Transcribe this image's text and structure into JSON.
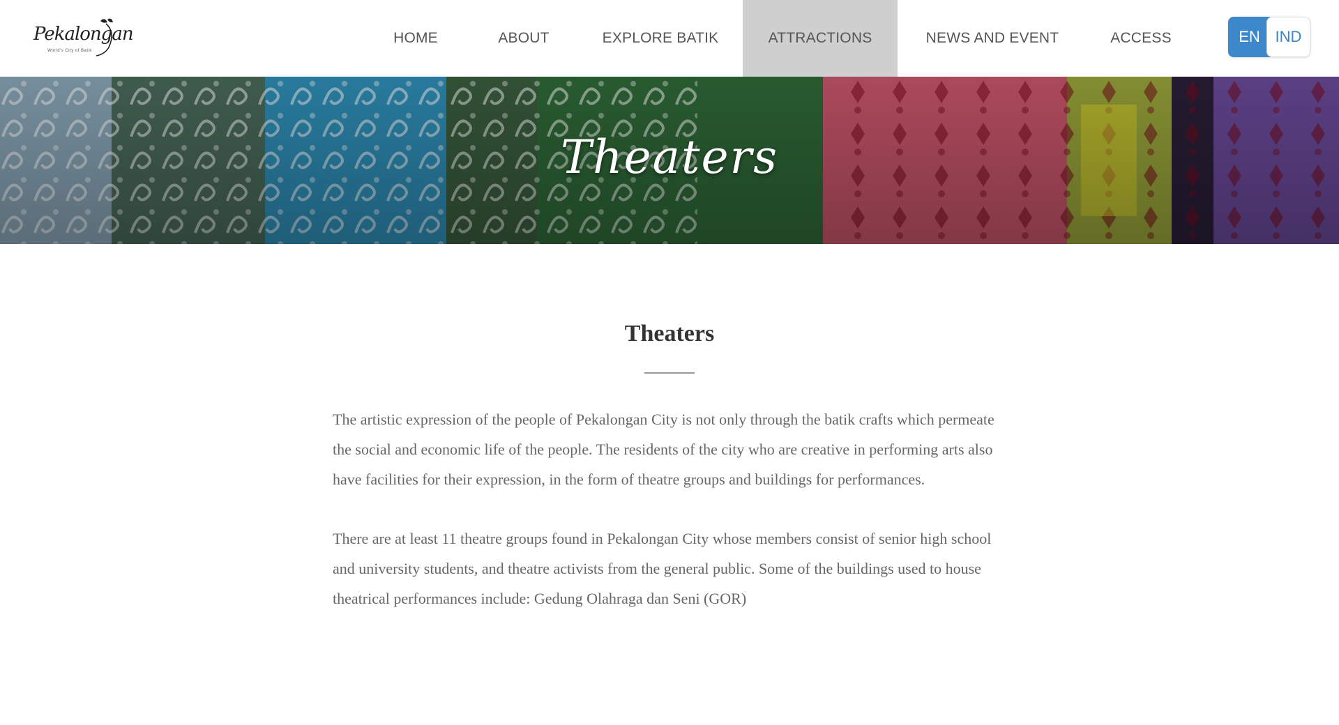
{
  "logo": {
    "name": "Pekalongan",
    "tagline": "World's City of Batik"
  },
  "nav": {
    "items": [
      {
        "label": "HOME",
        "active": false
      },
      {
        "label": "ABOUT",
        "active": false
      },
      {
        "label": "EXPLORE BATIK",
        "active": false
      },
      {
        "label": "ATTRACTIONS",
        "active": true
      },
      {
        "label": "NEWS AND EVENT",
        "active": false
      },
      {
        "label": "ACCESS",
        "active": false
      }
    ],
    "active_bg": "#cfcfcf"
  },
  "language": {
    "selected": "EN",
    "options": [
      "EN",
      "IND"
    ],
    "accent": "#3d87cb"
  },
  "banner": {
    "title": "Theaters"
  },
  "main": {
    "title": "Theaters",
    "paragraphs": [
      "The artistic expression of the people of Pekalongan City is not only through the batik crafts which permeate the social and economic life of the people. The residents of the city who are creative in performing arts also have facilities for their expression, in the form of theatre groups and buildings for performances.",
      "There are at least 11 theatre groups found in Pekalongan City whose members consist of senior high school and university students, and theatre activists from the general public. Some of the buildings used to house theatrical performances include: Gedung Olahraga dan Seni (GOR)"
    ]
  }
}
